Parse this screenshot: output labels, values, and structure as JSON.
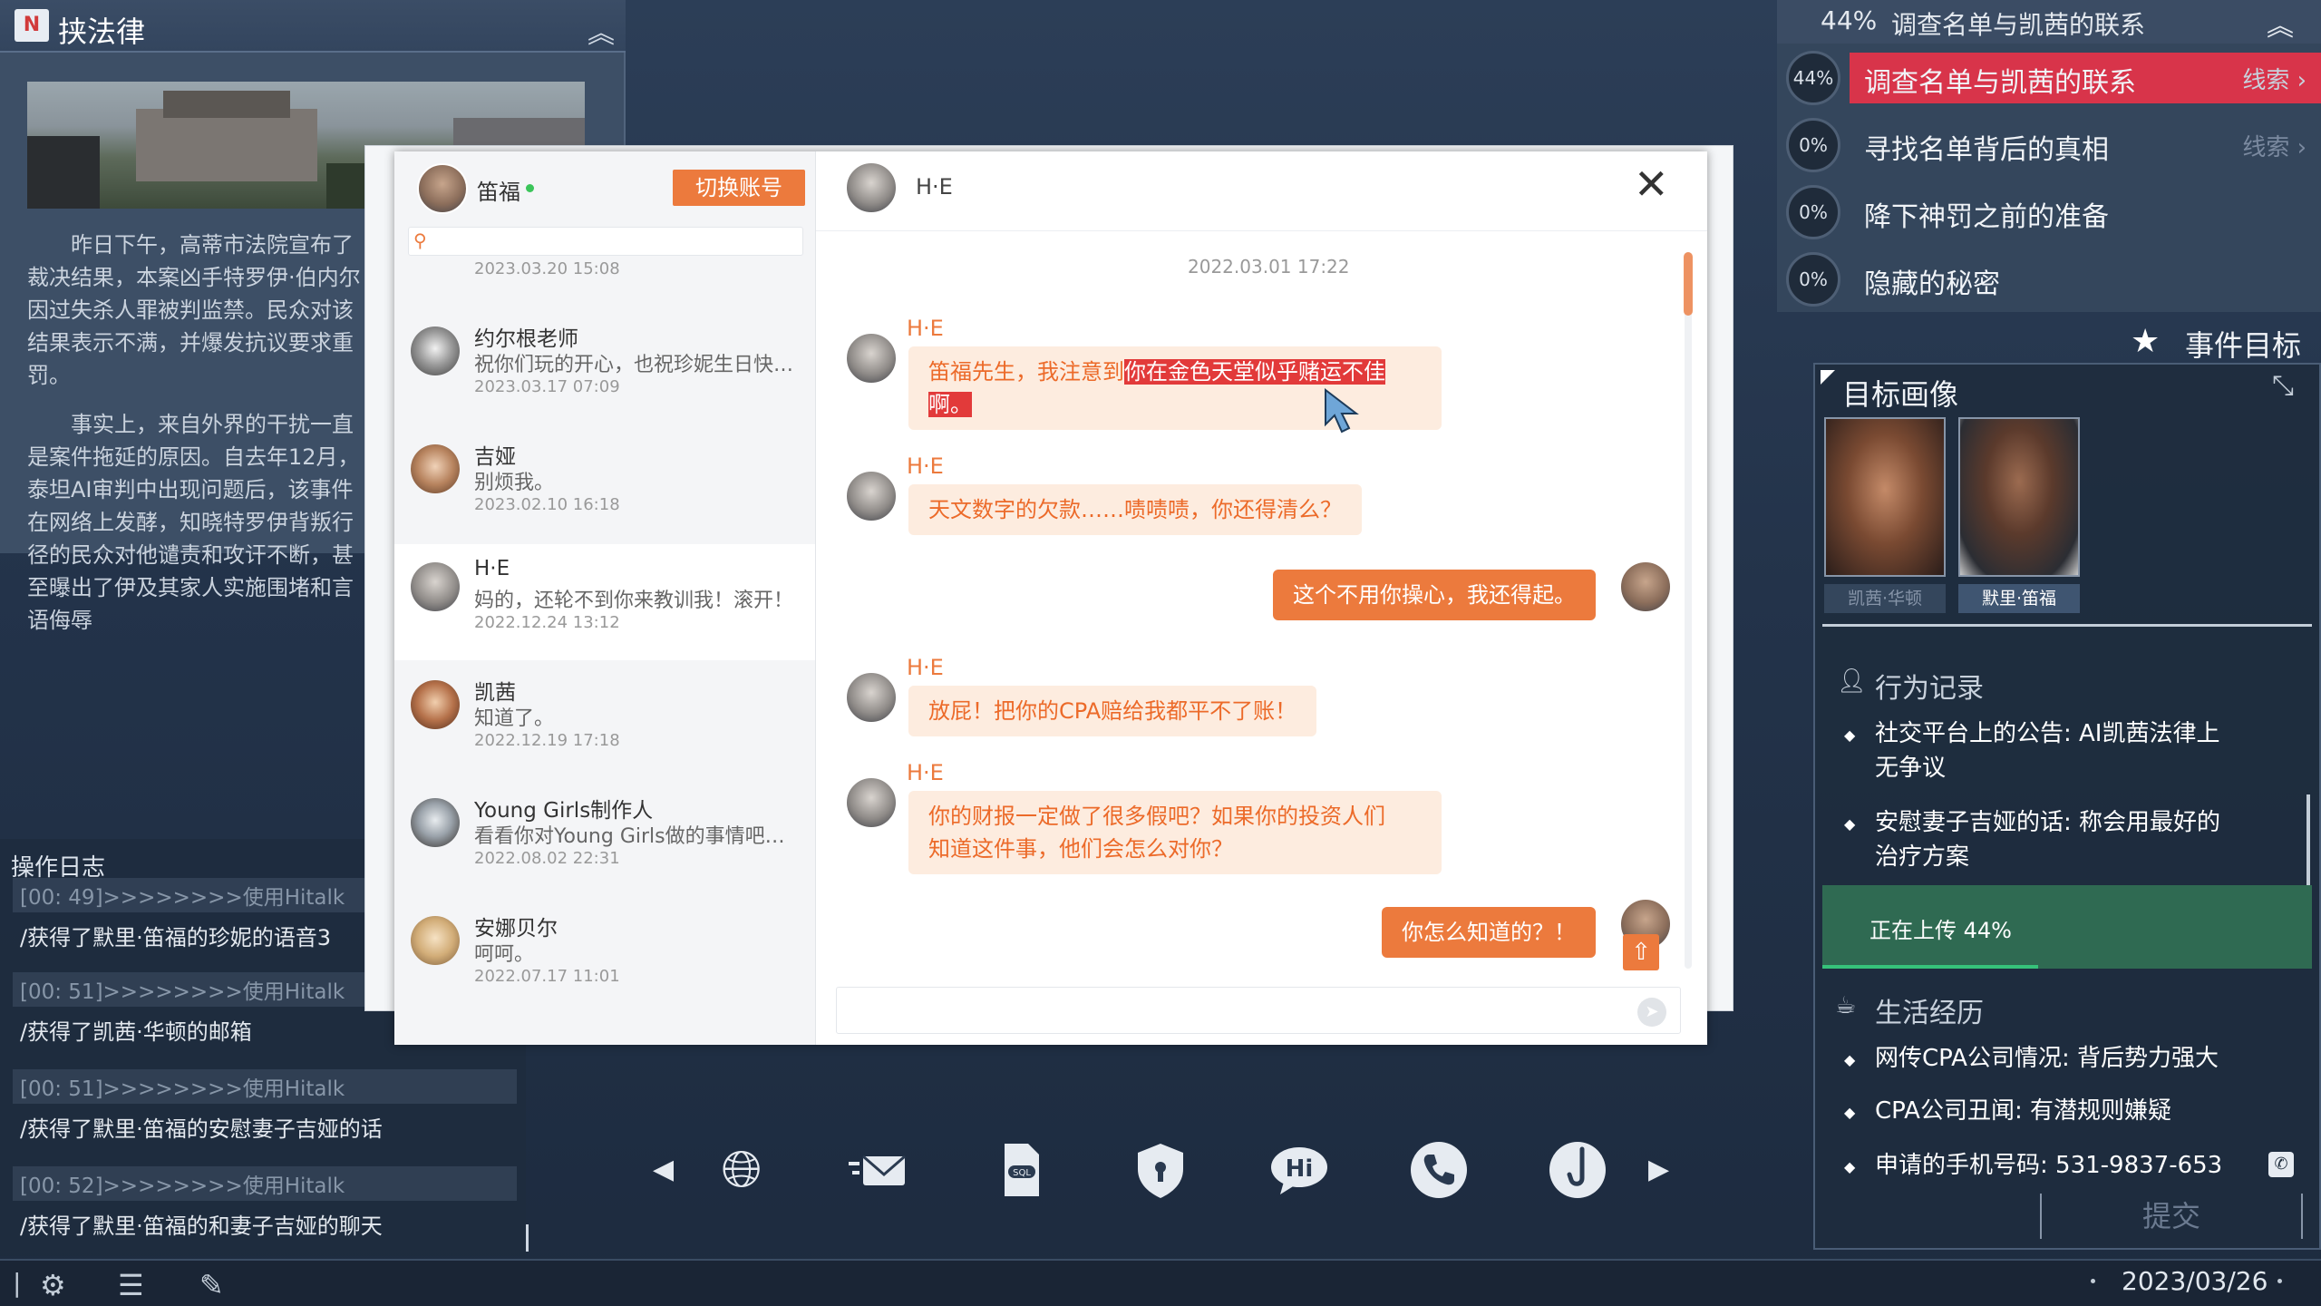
{
  "news": {
    "title": "挟法律",
    "paragraph1": "昨日下午，高蒂市法院宣布了裁决结果，本案凶手特罗伊·伯内尔因过失杀人罪被判监禁。民众对该结果表示不满，并爆发抗议要求重罚。",
    "paragraph2": "事实上，来自外界的干扰一直是案件拖延的原因。自去年12月，泰坦AI审判中出现问题后，该事件在网络上发酵，知晓特罗伊背叛行径的民众对他谴责和攻讦不断，甚至曝出了伊及其家人实施围堵和言语侮辱"
  },
  "log": {
    "title": "操作日志",
    "entries": [
      {
        "time": "[00: 49]>>>>>>>>使用Hitalk",
        "text": "/获得了默里·笛福的珍妮的语音3"
      },
      {
        "time": "[00: 51]>>>>>>>>使用Hitalk",
        "text": "/获得了凯茜·华顿的邮箱"
      },
      {
        "time": "[00: 51]>>>>>>>>使用Hitalk",
        "text": "/获得了默里·笛福的安慰妻子吉娅的话"
      },
      {
        "time": "[00: 52]>>>>>>>>使用Hitalk",
        "text": "/获得了默里·笛福的和妻子吉娅的聊天"
      }
    ]
  },
  "chat": {
    "me_name": "笛福",
    "switch_account": "切换账号",
    "prev_time": "2023.03.20  15:08",
    "contacts": [
      {
        "name": "约尔根老师",
        "msg": "祝你们玩的开心，也祝珍妮生日快乐！",
        "time": "2023.03.17  07:09"
      },
      {
        "name": "吉娅",
        "msg": "别烦我。",
        "time": "2023.02.10  16:18"
      },
      {
        "name": "H·E",
        "msg": "妈的，还轮不到你来教训我！滚开！",
        "time": "2022.12.24  13:12"
      },
      {
        "name": "凯茜",
        "msg": "知道了。",
        "time": "2022.12.19  17:18"
      },
      {
        "name": "Young Girls制作人",
        "msg": "看看你对Young Girls做的事情吧……",
        "time": "2022.08.02  22:31"
      },
      {
        "name": "安娜贝尔",
        "msg": "呵呵。",
        "time": "2022.07.17  11:01"
      }
    ],
    "partner_name": "H·E",
    "date": "2022.03.01  17:22",
    "messages": [
      {
        "sender": "H·E",
        "text_before": "笛福先生，我注意到",
        "text_hl1": "你在金色天堂似乎赌运不佳",
        "text_hl2": "啊。"
      },
      {
        "sender": "H·E",
        "text": "天文数字的欠款……啧啧啧，你还得清么？"
      },
      {
        "sender": "me",
        "text": "这个不用你操心，我还得起。"
      },
      {
        "sender": "H·E",
        "text": "放屁！把你的CPA赔给我都平不了账！"
      },
      {
        "sender": "H·E",
        "line1": "你的财报一定做了很多假吧？如果你的投资人们",
        "line2": "知道这件事，他们会怎么对你？"
      },
      {
        "sender": "me",
        "text": "你怎么知道的？！"
      }
    ]
  },
  "dock": {
    "icons": [
      "globe-icon",
      "mail-icon",
      "sql-icon",
      "shield-icon",
      "hitalk-icon",
      "phone-icon",
      "hook-icon"
    ]
  },
  "objectives": {
    "header_pct": "44%",
    "header_text": "调查名单与凯茜的联系",
    "items": [
      {
        "pct": "44%",
        "label": "调查名单与凯茜的联系",
        "clue": "线索",
        "progress": 0.44
      },
      {
        "pct": "0%",
        "label": "寻找名单背后的真相",
        "clue": "线索",
        "progress": 0
      },
      {
        "pct": "0%",
        "label": "降下神罚之前的准备",
        "clue": "",
        "progress": 0
      },
      {
        "pct": "0%",
        "label": "隐藏的秘密",
        "clue": "",
        "progress": 0
      }
    ],
    "event_goal": "事件目标"
  },
  "profile": {
    "title": "目标画像",
    "portraits": [
      {
        "label": "凯茜·华顿"
      },
      {
        "label": "默里·笛福"
      }
    ],
    "behavior_title": "行为记录",
    "behavior_items": [
      {
        "line1": "社交平台上的公告: AI凯茜法律上",
        "line2": "无争议"
      },
      {
        "line1": "安慰妻子吉娅的话: 称会用最好的",
        "line2": "治疗方案"
      }
    ],
    "upload_text": "正在上传  44%",
    "upload_progress": 0.44,
    "life_title": "生活经历",
    "life_items": [
      "网传CPA公司情况: 背后势力强大",
      "CPA公司丑闻: 有潜规则嫌疑",
      "申请的手机号码: 531-9837-653"
    ],
    "submit": "提交"
  },
  "status": {
    "date": "2023/03/26"
  }
}
